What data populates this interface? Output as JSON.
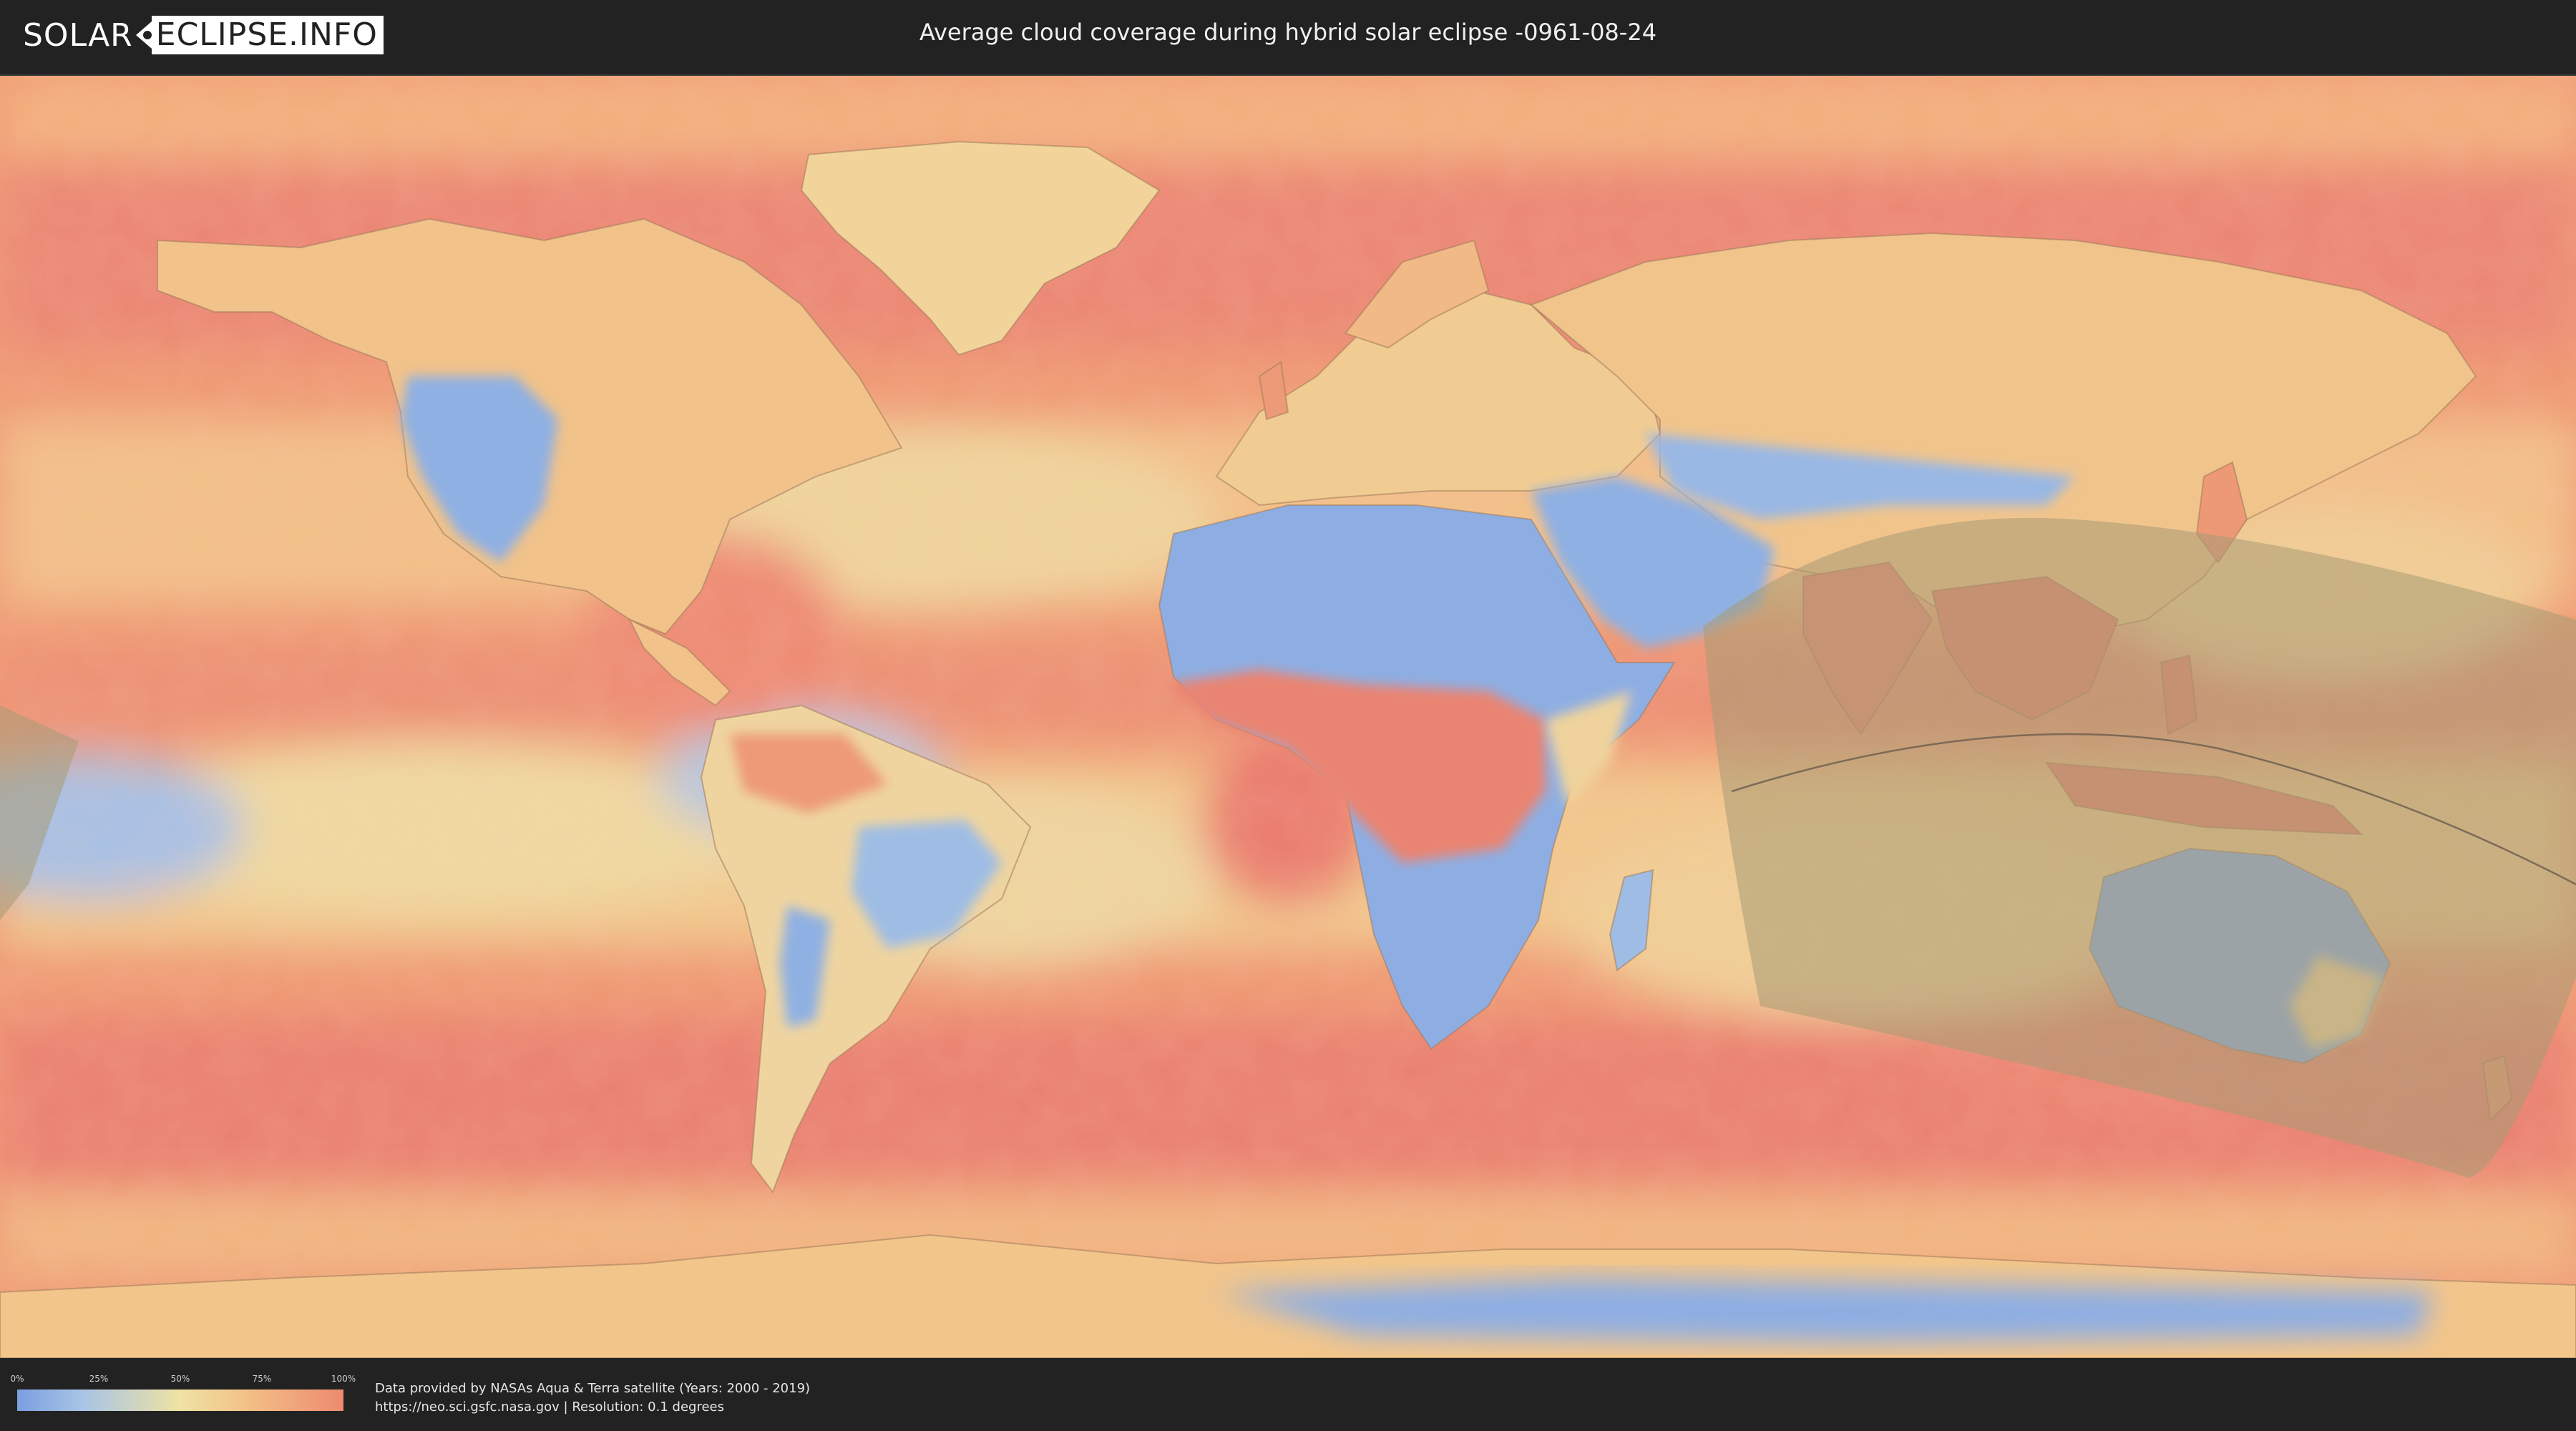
{
  "header": {
    "logo_left": "SOLAR",
    "logo_right": "ECLIPSE.INFO",
    "title": "Average cloud coverage during hybrid solar eclipse -0961-08-24"
  },
  "legend": {
    "ticks": [
      "0%",
      "25%",
      "50%",
      "75%",
      "100%"
    ],
    "colors": [
      "#7a9fe0",
      "#a8c4e6",
      "#efe2a4",
      "#f3c187",
      "#ee8a6f"
    ]
  },
  "footer": {
    "credit_line_1": "Data provided by NASAs Aqua & Terra satellite (Years: 2000 - 2019)",
    "credit_line_2": "https://neo.sci.gsfc.nasa.gov | Resolution: 0.1 degrees"
  },
  "map": {
    "projection": "equirectangular",
    "overlay": "eclipse visibility zone with central path line",
    "palette": {
      "ocean_cloudy": "#ec8b72",
      "ocean_mid": "#f2b783",
      "clear": "#7fa3e0",
      "partly": "#efdfa3",
      "overlay": "#b7a27a"
    }
  }
}
